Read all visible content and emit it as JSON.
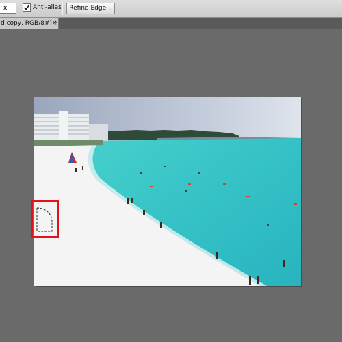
{
  "options": {
    "feather_value": "x",
    "antialias_label": "Anti-alias",
    "antialias_checked": true,
    "refine_edge_label": "Refine Edge..."
  },
  "document_tab": {
    "title": "d copy, RGB/8#) *",
    "close_glyph": "×"
  },
  "icons": {
    "checkmark": "checkmark-icon",
    "close": "close-icon"
  },
  "colors": {
    "workspace": "#6a6a6a",
    "options_bar": "#d3d3d3",
    "highlight": "#e3121b",
    "sea": "#3cc6c4",
    "sand": "#f3f3f3"
  }
}
